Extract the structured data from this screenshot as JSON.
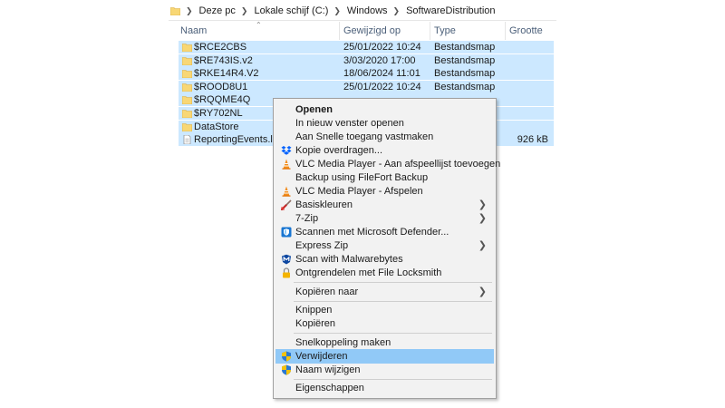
{
  "breadcrumb": [
    "Deze pc",
    "Lokale schijf (C:)",
    "Windows",
    "SoftwareDistribution"
  ],
  "columns": {
    "name": "Naam",
    "date": "Gewijzigd op",
    "type": "Type",
    "size": "Grootte"
  },
  "files": [
    {
      "name": "$RCE2CBS",
      "date": "25/01/2022 10:24",
      "type": "Bestandsmap",
      "size": ""
    },
    {
      "name": "$RE743IS.v2",
      "date": "3/03/2020 17:00",
      "type": "Bestandsmap",
      "size": ""
    },
    {
      "name": "$RKE14R4.V2",
      "date": "18/06/2024 11:01",
      "type": "Bestandsmap",
      "size": ""
    },
    {
      "name": "$ROOD8U1",
      "date": "25/01/2022 10:24",
      "type": "Bestandsmap",
      "size": ""
    },
    {
      "name": "$RQQME4Q",
      "date": "",
      "type": "",
      "size": ""
    },
    {
      "name": "$RY702NL",
      "date": "",
      "type": "",
      "size": ""
    },
    {
      "name": "DataStore",
      "date": "",
      "type": "",
      "size": ""
    },
    {
      "name": "ReportingEvents.log",
      "date": "",
      "type": "",
      "size": "926 kB"
    }
  ],
  "menu": {
    "open": "Openen",
    "open_new_window": "In nieuw venster openen",
    "pin_quick_access": "Aan Snelle toegang vastmaken",
    "copy_transfer": "Kopie overdragen...",
    "vlc_add_playlist": "VLC Media Player - Aan afspeellijst toevoegen",
    "filefort_backup": "Backup using FileFort Backup",
    "vlc_play": "VLC Media Player - Afspelen",
    "basic_colors": "Basiskleuren",
    "seven_zip": "7-Zip",
    "defender_scan": "Scannen met Microsoft Defender...",
    "express_zip": "Express Zip",
    "malwarebytes": "Scan with Malwarebytes",
    "file_locksmith": "Ontgrendelen met File Locksmith",
    "copy_to": "Kopiëren naar",
    "cut": "Knippen",
    "copy": "Kopiëren",
    "create_shortcut": "Snelkoppeling maken",
    "delete": "Verwijderen",
    "rename": "Naam wijzigen",
    "properties": "Eigenschappen"
  },
  "colors": {
    "selection": "#cce8ff",
    "menu_highlight": "#91c9f7",
    "menu_background": "#f2f2f2",
    "folder": "#f8d775",
    "header_text": "#4c607a"
  }
}
